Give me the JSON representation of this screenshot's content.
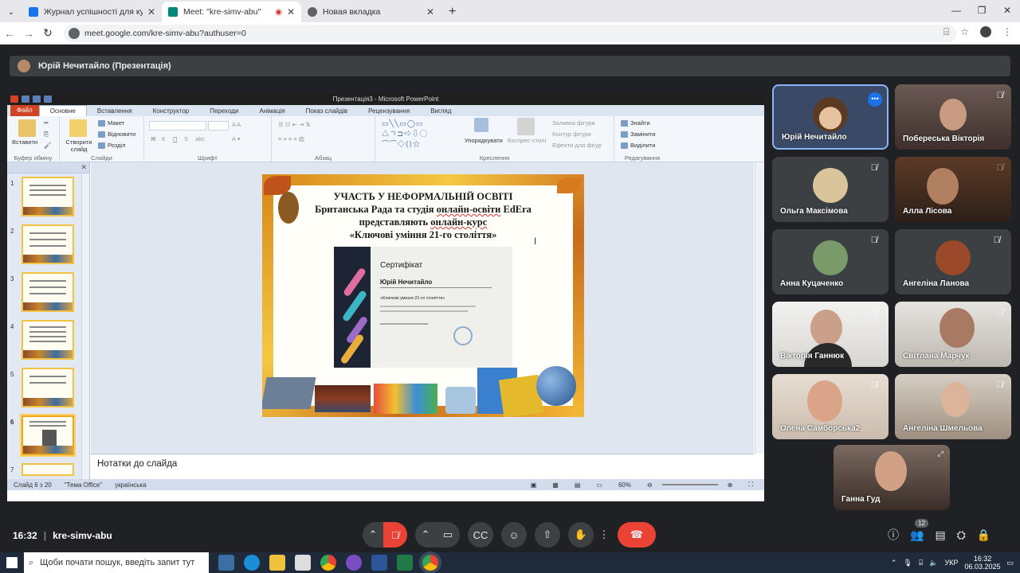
{
  "browser": {
    "tabs": [
      {
        "title": "Журнал успішності для курсу",
        "color": "#1a73e8"
      },
      {
        "title": "Meet: \"kre-simv-abu\"",
        "color": "#00897b"
      },
      {
        "title": "Новая вкладка",
        "color": "#5f6368"
      }
    ],
    "url": "meet.google.com/kre-simv-abu?authuser=0"
  },
  "meet": {
    "presenter_label": "Юрій Нечитайло (Презентація)",
    "time": "16:32",
    "meeting_code": "kre-simv-abu",
    "participant_count": "12",
    "participants": [
      {
        "name": "Юрій Нечитайло",
        "muted": false,
        "active": true
      },
      {
        "name": "Побереська Вікторія",
        "muted": true
      },
      {
        "name": "Ольга Максімова",
        "muted": true
      },
      {
        "name": "Алла Лісова",
        "muted": true
      },
      {
        "name": "Анна Куцаченко",
        "muted": true
      },
      {
        "name": "Ангеліна Ланова",
        "muted": true
      },
      {
        "name": "Вікторія Ганнюк",
        "muted": true
      },
      {
        "name": "Світлана Марчук",
        "muted": true
      },
      {
        "name": "Олена Самборська2",
        "muted": true
      },
      {
        "name": "Ангеліна Шмельова",
        "muted": true
      },
      {
        "name": "Ганна Гуд",
        "muted": false
      }
    ]
  },
  "ppt": {
    "window_title": "Презентація3 - Microsoft PowerPoint",
    "tabs": [
      "Файл",
      "Основне",
      "Вставлення",
      "Конструктор",
      "Переходи",
      "Анімація",
      "Показ слайдів",
      "Рецензування",
      "Вигляд"
    ],
    "groups": {
      "clipboard": "Буфер обміну",
      "paste": "Вставити",
      "slides": "Слайди",
      "new_slide": "Створити слайд",
      "layout": "Макет",
      "reset": "Відновити",
      "section": "Розділ",
      "font": "Шрифт",
      "paragraph": "Абзац",
      "drawing": "Креслення",
      "arrange": "Упорядкувати",
      "quick_styles": "Експрес-стилі",
      "shape_fill": "Заливка фігури",
      "shape_outline": "Контур фігури",
      "shape_effects": "Ефекти для фігур",
      "editing": "Редагування",
      "find": "Знайти",
      "replace": "Замінити",
      "select": "Виділити"
    },
    "slide": {
      "line1": "УЧАСТЬ У НЕФОРМАЛЬНІЙ  ОСВІТІ",
      "line2a": "Британська Рада та студія ",
      "line2b": "онлайн-освіти",
      "line2c": " EdEra",
      "line3a": "представляють ",
      "line3b": "онлайн-курс",
      "line4": "«Ключові уміння  21-го століття»",
      "cert_title": "Сертифікат",
      "cert_name": "Юрій Нечитайло",
      "cert_course": "«Ключові уміння 21-го століття»"
    },
    "notes_placeholder": "Нотатки до слайда",
    "status": {
      "slide": "Слайд 6 з 20",
      "theme": "\"Тема Office\"",
      "lang": "українська",
      "zoom": "60%"
    },
    "thumb_numbers": [
      "1",
      "2",
      "3",
      "4",
      "5",
      "6",
      "7"
    ]
  },
  "taskbar": {
    "search_placeholder": "Щоби почати пошук, введіть запит тут",
    "lang": "УКР",
    "time": "16:32",
    "date": "06.03.2025"
  }
}
